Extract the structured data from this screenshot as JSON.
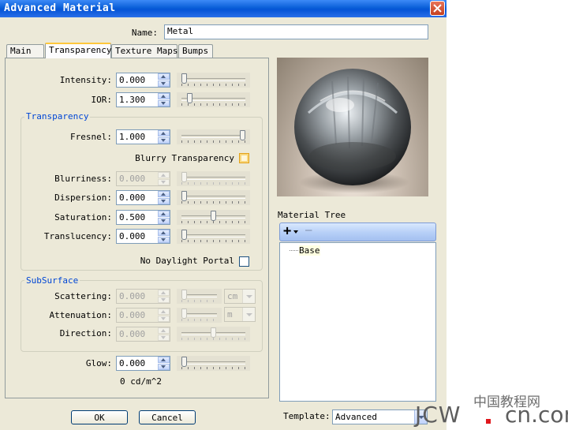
{
  "window": {
    "title": "Advanced Material",
    "close_icon": "close-icon"
  },
  "name": {
    "label": "Name:",
    "value": "Metal"
  },
  "tabs": [
    "Main",
    "Transparency",
    "Texture Maps",
    "Bumps"
  ],
  "selected_tab": "Transparency",
  "top": {
    "intensity": {
      "label": "Intensity:",
      "value": "0.000",
      "level": 0.0
    },
    "ior": {
      "label": "IOR:",
      "value": "1.300",
      "level": 0.1
    }
  },
  "transparency": {
    "title": "Transparency",
    "fresnel": {
      "label": "Fresnel:",
      "value": "1.000",
      "level": 1.0
    },
    "blurry_label": "Blurry Transparency",
    "blurriness": {
      "label": "Blurriness:",
      "value": "0.000",
      "level": 0.0
    },
    "dispersion": {
      "label": "Dispersion:",
      "value": "0.000",
      "level": 0.0
    },
    "saturation": {
      "label": "Saturation:",
      "value": "0.500",
      "level": 0.5
    },
    "translucency": {
      "label": "Translucency:",
      "value": "0.000",
      "level": 0.0
    },
    "no_daylight_label": "No Daylight Portal"
  },
  "subsurface": {
    "title": "SubSurface",
    "scattering": {
      "label": "Scattering:",
      "value": "0.000",
      "unit": "cm",
      "level": 0.0
    },
    "attenuation": {
      "label": "Attenuation:",
      "value": "0.000",
      "unit": "m",
      "level": 0.0
    },
    "direction": {
      "label": "Direction:",
      "value": "0.000",
      "level": 0.5
    }
  },
  "glow": {
    "label": "Glow:",
    "value": "0.000",
    "unit_text": "0 cd/m^2",
    "level": 0.0
  },
  "buttons": {
    "ok": "OK",
    "cancel": "Cancel"
  },
  "material_tree": {
    "title": "Material Tree",
    "add": "+",
    "remove": "—",
    "items": [
      "Base"
    ]
  },
  "template": {
    "label": "Template:",
    "value": "Advanced"
  },
  "watermark": {
    "cn": "中国教程网",
    "latin_a": "JCW",
    "latin_b": "cn.com"
  },
  "colors": {
    "titlebar": "#0a5fd8",
    "group_title": "#0046d5",
    "dialog_bg": "#ece9d8"
  }
}
